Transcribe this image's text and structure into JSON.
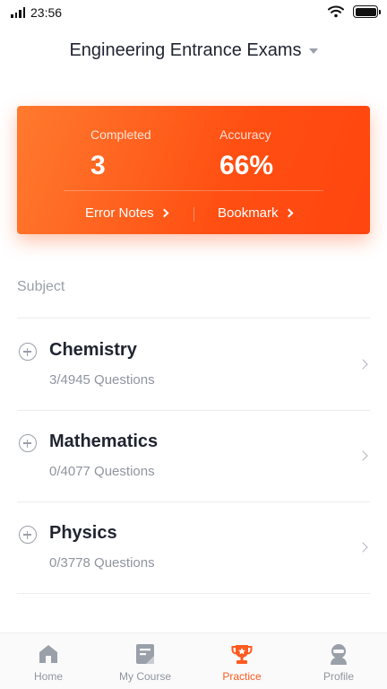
{
  "status": {
    "time": "23:56",
    "battery_level": 1.0
  },
  "header": {
    "title": "Engineering Entrance Exams"
  },
  "stats": {
    "completed_label": "Completed",
    "completed_value": "3",
    "accuracy_label": "Accuracy",
    "accuracy_value": "66%",
    "error_notes_label": "Error Notes",
    "bookmark_label": "Bookmark"
  },
  "subjects_section": {
    "label": "Subject",
    "items": [
      {
        "name": "Chemistry",
        "count": "3/4945 Questions"
      },
      {
        "name": "Mathematics",
        "count": "0/4077 Questions"
      },
      {
        "name": "Physics",
        "count": "0/3778 Questions"
      }
    ]
  },
  "tabs": [
    {
      "label": "Home",
      "icon": "home-icon",
      "active": false
    },
    {
      "label": "My Course",
      "icon": "course-icon",
      "active": false
    },
    {
      "label": "Practice",
      "icon": "trophy-icon",
      "active": true
    },
    {
      "label": "Profile",
      "icon": "profile-icon",
      "active": false
    }
  ],
  "colors": {
    "accent": "#ff5a1f",
    "card_gradient_start": "#ff7a2e",
    "card_gradient_end": "#ff4510",
    "inactive_gray": "#8f95a0"
  }
}
